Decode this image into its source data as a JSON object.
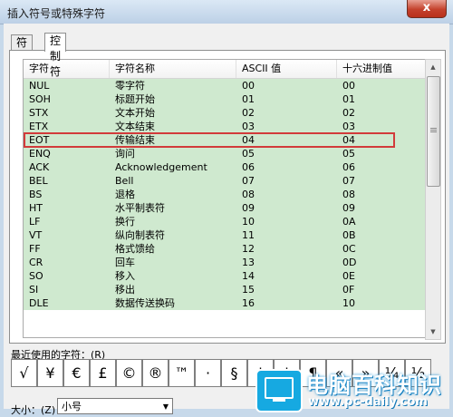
{
  "window": {
    "title": "插入符号或特殊字符",
    "close_label": "x"
  },
  "tabs": [
    {
      "label": "符号"
    },
    {
      "label": "控制符"
    }
  ],
  "table": {
    "headers": [
      "字符",
      "字符名称",
      "ASCII 值",
      "十六进制值"
    ],
    "rows": [
      [
        "NUL",
        "零字符",
        "00",
        "00"
      ],
      [
        "SOH",
        "标题开始",
        "01",
        "01"
      ],
      [
        "STX",
        "文本开始",
        "02",
        "02"
      ],
      [
        "ETX",
        "文本结束",
        "03",
        "03"
      ],
      [
        "EOT",
        "传输结束",
        "04",
        "04"
      ],
      [
        "ENQ",
        "询问",
        "05",
        "05"
      ],
      [
        "ACK",
        "Acknowledgement",
        "06",
        "06"
      ],
      [
        "BEL",
        "Bell",
        "07",
        "07"
      ],
      [
        "BS",
        "退格",
        "08",
        "08"
      ],
      [
        "HT",
        "水平制表符",
        "09",
        "09"
      ],
      [
        "LF",
        "换行",
        "10",
        "0A"
      ],
      [
        "VT",
        "纵向制表符",
        "11",
        "0B"
      ],
      [
        "FF",
        "格式馈给",
        "12",
        "0C"
      ],
      [
        "CR",
        "回车",
        "13",
        "0D"
      ],
      [
        "SO",
        "移入",
        "14",
        "0E"
      ],
      [
        "SI",
        "移出",
        "15",
        "0F"
      ],
      [
        "DLE",
        "数据传送换码",
        "16",
        "10"
      ]
    ],
    "row_color": "#cfe9cf",
    "highlight_color": "#d23b3b"
  },
  "recent": {
    "label": "最近使用的字符：(R)",
    "glyphs": [
      "√",
      "¥",
      "€",
      "£",
      "©",
      "®",
      "™",
      "·",
      "§",
      "†",
      "‡",
      "¶",
      "«",
      "»",
      "¼",
      "½"
    ]
  },
  "size": {
    "label": "大小：(Z)",
    "value": "小号"
  },
  "watermark": {
    "title": "电脑百科知识",
    "url": "www.pc-daily.com",
    "color": "#16a9e1"
  }
}
